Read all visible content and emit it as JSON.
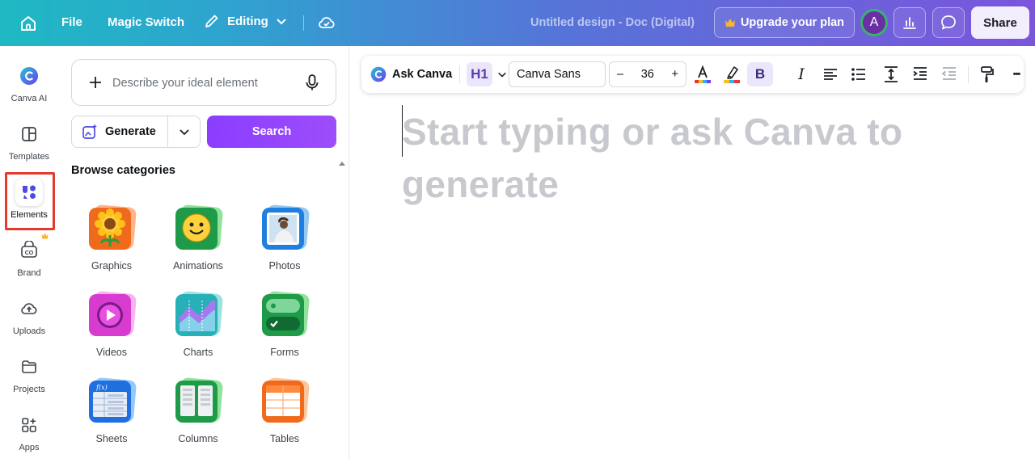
{
  "topbar": {
    "file": "File",
    "magic_switch": "Magic Switch",
    "editing": "Editing",
    "doc_title": "Untitled design - Doc (Digital)",
    "upgrade": "Upgrade your plan",
    "avatar_initial": "A",
    "share": "Share"
  },
  "rail": {
    "items": [
      {
        "label": "Canva AI",
        "icon": "canva-ai-icon"
      },
      {
        "label": "Templates",
        "icon": "templates-icon"
      },
      {
        "label": "Elements",
        "icon": "elements-icon",
        "active": true
      },
      {
        "label": "Brand",
        "icon": "brand-icon"
      },
      {
        "label": "Uploads",
        "icon": "uploads-icon"
      },
      {
        "label": "Projects",
        "icon": "projects-icon"
      },
      {
        "label": "Apps",
        "icon": "apps-icon"
      }
    ]
  },
  "panel": {
    "search_placeholder": "Describe your ideal element",
    "generate": "Generate",
    "search": "Search",
    "browse": "Browse categories",
    "categories": [
      {
        "label": "Graphics"
      },
      {
        "label": "Animations"
      },
      {
        "label": "Photos"
      },
      {
        "label": "Videos"
      },
      {
        "label": "Charts"
      },
      {
        "label": "Forms"
      },
      {
        "label": "Sheets"
      },
      {
        "label": "Columns"
      },
      {
        "label": "Tables"
      }
    ]
  },
  "toolbar": {
    "ask_canva": "Ask Canva",
    "heading": "H1",
    "font": "Canva Sans",
    "size_minus": "–",
    "size": "36",
    "size_plus": "+",
    "bold": "B",
    "italic": "I",
    "more": "•••"
  },
  "document": {
    "placeholder": "Start typing or ask Canva to generate"
  },
  "colors": {
    "accent": "#8b3dff",
    "highlight": "#e23b2e"
  }
}
